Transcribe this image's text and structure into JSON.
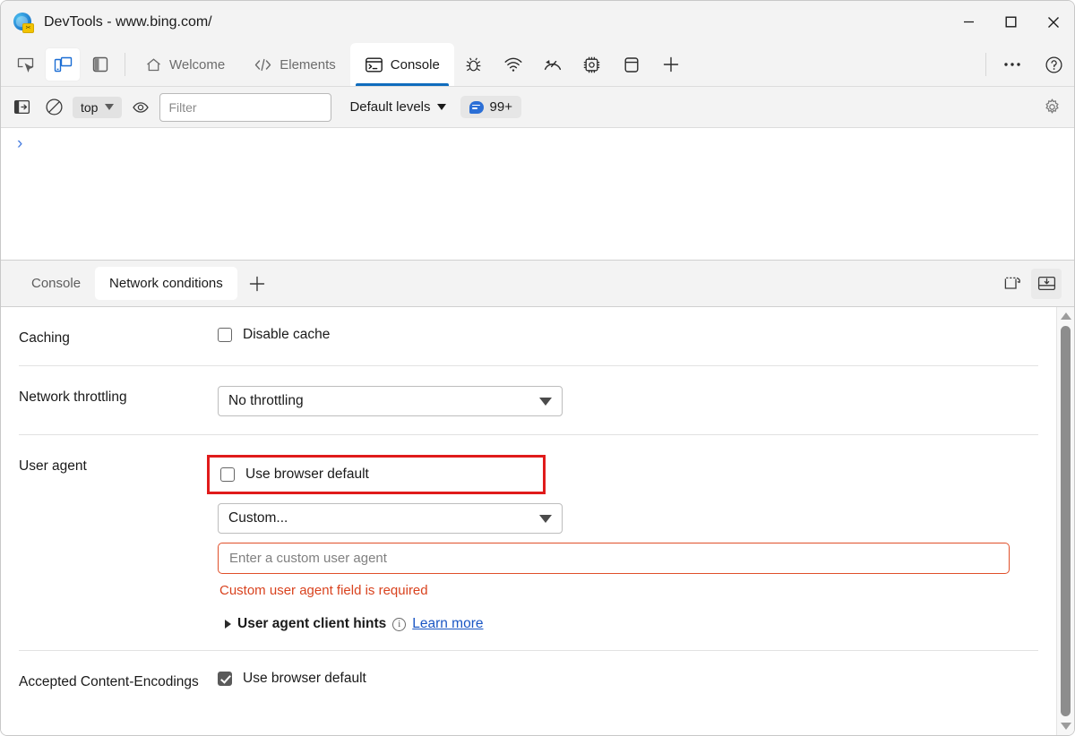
{
  "window": {
    "title": "DevTools - www.bing.com/",
    "app_icon": "edge-devtools-icon",
    "minimize_label": "─",
    "maximize_label": "□",
    "close_label": "✕"
  },
  "toolbar": {
    "left_icons": [
      {
        "name": "inspect-element-icon",
        "label": "Inspect"
      },
      {
        "name": "device-emulation-icon",
        "label": "Toggle device emulation"
      },
      {
        "name": "dock-side-icon",
        "label": "Dock side"
      }
    ],
    "tabs": [
      {
        "label": "Welcome",
        "icon": "home-icon",
        "active": false
      },
      {
        "label": "Elements",
        "icon": "code-brackets-icon",
        "active": false
      },
      {
        "label": "Console",
        "icon": "console-prompt-icon",
        "active": true
      }
    ],
    "icon_tabs": [
      {
        "name": "sources-bug-icon",
        "label": "Sources"
      },
      {
        "name": "network-wifi-icon",
        "label": "Network"
      },
      {
        "name": "performance-gauge-icon",
        "label": "Performance"
      },
      {
        "name": "memory-chip-icon",
        "label": "Memory"
      },
      {
        "name": "application-database-icon",
        "label": "Application"
      },
      {
        "name": "add-tab-plus-icon",
        "label": "+"
      }
    ],
    "more_label": "⋯",
    "help_label": "?"
  },
  "console_bar": {
    "sidebar_toggle_icon": "console-sidebar-icon",
    "clear_icon": "clear-console-icon",
    "context": "top",
    "eye_icon": "live-expression-icon",
    "filter_placeholder": "Filter",
    "filter_value": "",
    "levels_label": "Default levels",
    "issues_count": "99+",
    "issues_icon": "issues-bubble-icon",
    "settings_icon": "gear-icon"
  },
  "console_output": {
    "prompt": "›"
  },
  "drawer": {
    "tabs": [
      {
        "label": "Console",
        "active": false
      },
      {
        "label": "Network conditions",
        "active": true
      }
    ],
    "add_tab_label": "+",
    "right_icons": [
      {
        "name": "restore-drawer-icon",
        "label": "Restore drawer"
      },
      {
        "name": "dock-to-bottom-icon",
        "label": "Dock to bottom"
      }
    ]
  },
  "network_conditions": {
    "rows": [
      {
        "label": "Caching",
        "checkbox_label": "Disable cache",
        "checked": false
      },
      {
        "label": "Network throttling",
        "dropdown_value": "No throttling"
      },
      {
        "label": "User agent",
        "checkbox_label": "Use browser default",
        "checked": false,
        "highlighted": true,
        "dropdown_value": "Custom...",
        "input_placeholder": "Enter a custom user agent",
        "input_value": "",
        "error_text": "Custom user agent field is required",
        "hints_label": "User agent client hints",
        "hints_info_icon": "info-icon",
        "learn_more_label": "Learn more"
      },
      {
        "label": "Accepted Content-Encodings",
        "checkbox_label": "Use browser default",
        "checked": true
      }
    ]
  },
  "scrollbar": {
    "up_arrow": "scroll-up-arrow",
    "down_arrow": "scroll-down-arrow"
  },
  "colors": {
    "accent_blue": "#0f6cbd",
    "highlight_red": "#e01b1b",
    "error_orange": "#d9431f",
    "link_blue": "#1a56c4"
  }
}
